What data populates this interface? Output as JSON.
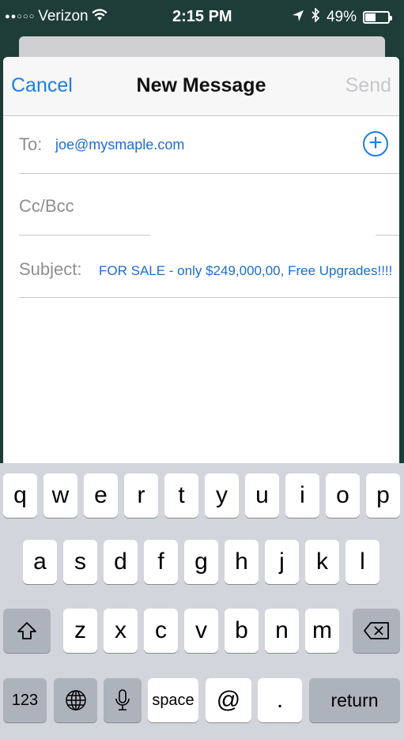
{
  "status_bar": {
    "signal_dots": "●●○○○",
    "carrier": "Verizon",
    "wifi": "wifi-icon",
    "time": "2:15 PM",
    "location": "location-arrow-icon",
    "bluetooth": "bluetooth-icon",
    "battery_percent": "49%",
    "battery_level": 0.49
  },
  "nav": {
    "cancel_label": "Cancel",
    "title": "New Message",
    "send_label": "Send"
  },
  "compose": {
    "to_label": "To:",
    "to_value": "joe@mysmaple.com",
    "add_contact": "+",
    "cc_label": "Cc/Bcc",
    "subject_label": "Subject:",
    "subject_value": "FOR SALE - only $249,000,00, Free Upgrades!!!!",
    "body": ""
  },
  "keyboard": {
    "row1": [
      "q",
      "w",
      "e",
      "r",
      "t",
      "y",
      "u",
      "i",
      "o",
      "p"
    ],
    "row2": [
      "a",
      "s",
      "d",
      "f",
      "g",
      "h",
      "j",
      "k",
      "l"
    ],
    "row3": [
      "z",
      "x",
      "c",
      "v",
      "b",
      "n",
      "m"
    ],
    "shift": "⇧",
    "delete": "⌫",
    "numbers": "123",
    "globe": "🌐",
    "mic": "🎙",
    "space": "space",
    "at": "@",
    "period": ".",
    "return": "return"
  }
}
